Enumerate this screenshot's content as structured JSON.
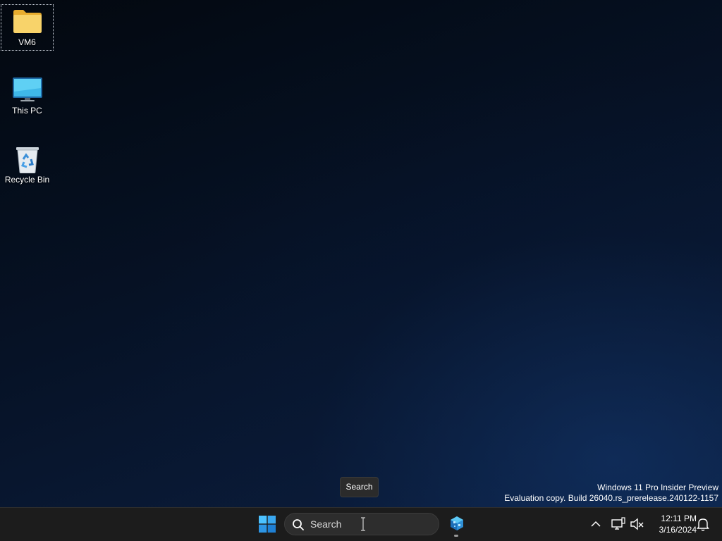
{
  "desktop": {
    "icons": [
      {
        "label": "VM6",
        "icon": "folder-icon",
        "selected": true
      },
      {
        "label": "This PC",
        "icon": "monitor-icon",
        "selected": false
      },
      {
        "label": "Recycle Bin",
        "icon": "recycle-bin-icon",
        "selected": false
      }
    ],
    "watermark": {
      "line1": "Windows 11 Pro Insider Preview",
      "line2": "Evaluation copy. Build 26040.rs_prerelease.240122-1157"
    },
    "tooltip": "Search"
  },
  "taskbar": {
    "start_icon": "windows-logo-icon",
    "search_placeholder": "Search",
    "pinned_app_icon": "app-cube-icon",
    "tray": {
      "icons": [
        "chevron-up-icon",
        "network-icon",
        "volume-muted-icon",
        "notification-bell-icon"
      ],
      "time": "12:11 PM",
      "date": "3/16/2024"
    }
  },
  "colors": {
    "accent": "#0078d4",
    "taskbar": "#1c1c1c",
    "folder": "#f3c24e"
  }
}
